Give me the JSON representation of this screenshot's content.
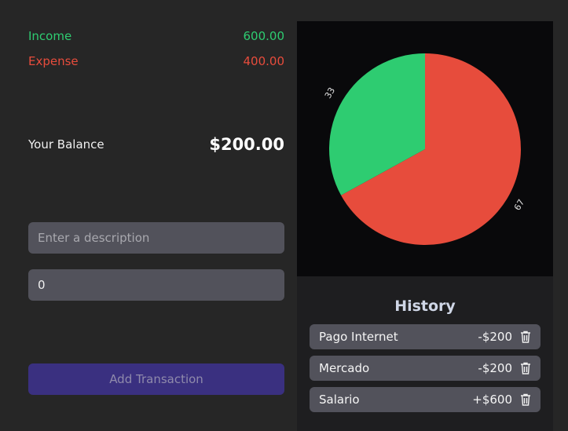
{
  "summary": {
    "income_label": "Income",
    "income_value": "600.00",
    "expense_label": "Expense",
    "expense_value": "400.00",
    "balance_label": "Your Balance",
    "balance_value": "$200.00"
  },
  "form": {
    "description_placeholder": "Enter a description",
    "description_value": "",
    "amount_value": "0",
    "add_label": "Add Transaction"
  },
  "colors": {
    "income": "#2ecc71",
    "expense": "#e74c3c",
    "button": "#3a3080"
  },
  "chart_data": {
    "type": "pie",
    "categories": [
      "Expense",
      "Income"
    ],
    "values": [
      67,
      33
    ],
    "colors": [
      "#e74c3c",
      "#2ecc71"
    ],
    "labels": [
      "67",
      "33"
    ]
  },
  "history": {
    "title": "History",
    "items": [
      {
        "description": "Pago Internet",
        "amount": "-$200",
        "icon": "trash-icon"
      },
      {
        "description": "Mercado",
        "amount": "-$200",
        "icon": "trash-icon"
      },
      {
        "description": "Salario",
        "amount": "+$600",
        "icon": "trash-icon"
      }
    ]
  }
}
